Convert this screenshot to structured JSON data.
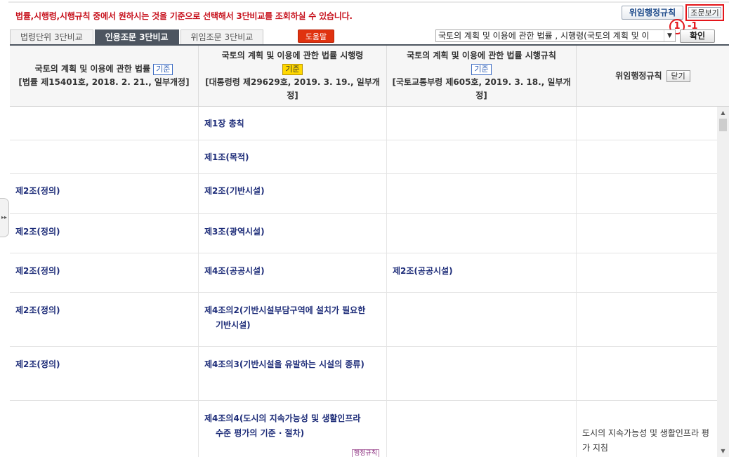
{
  "info_message": "법률,시행령,시행규칙 중에서 원하시는 것을 기준으로 선택해서 3단비교를 조회하실 수 있습니다.",
  "top_buttons": {
    "delegated_rules": "위임행정규칙",
    "article_view": "조문보기"
  },
  "annotation": {
    "number": "1",
    "suffix": "-1"
  },
  "tabs": [
    {
      "label": "법령단위 3단비교",
      "active": false
    },
    {
      "label": "인용조문 3단비교",
      "active": true
    },
    {
      "label": "위임조문 3단비교",
      "active": false
    }
  ],
  "help_label": "도움말",
  "law_select": {
    "value": "국토의 계획 및 이용에 관한 법률 , 시행령(국토의 계획 및 이",
    "arrow": "▼"
  },
  "confirm_label": "확인",
  "columns": [
    {
      "title": "국토의 계획 및 이용에 관한 법률",
      "badge": "기준",
      "sub": "[법률 제15401호, 2018. 2. 21., 일부개정]"
    },
    {
      "title": "국토의 계획 및 이용에 관한 법률 시행령",
      "badge": "기준",
      "sub": "[대통령령 제29629호, 2019. 3. 19., 일부개정]"
    },
    {
      "title": "국토의 계획 및 이용에 관한 법률 시행규칙",
      "badge": "기준",
      "sub": "[국토교통부령 제605호, 2019. 3. 18., 일부개정]"
    },
    {
      "title": "위임행정규칙",
      "close_label": "닫기"
    }
  ],
  "rows": [
    {
      "law": "",
      "decree": "제1장 총칙",
      "rule": "",
      "admin": ""
    },
    {
      "law": "",
      "decree": "제1조(목적)",
      "rule": "",
      "admin": ""
    },
    {
      "law": "제2조(정의)",
      "decree": "제2조(기반시설)",
      "rule": "",
      "admin": ""
    },
    {
      "law": "제2조(정의)",
      "decree": "제3조(광역시설)",
      "rule": "",
      "admin": ""
    },
    {
      "law": "제2조(정의)",
      "decree": "제4조(공공시설)",
      "rule": "제2조(공공시설)",
      "admin": ""
    },
    {
      "law": "제2조(정의)",
      "decree": "제4조의2(기반시설부담구역에 설치가 필요한 기반시설)",
      "rule": "",
      "admin": ""
    },
    {
      "law": "제2조(정의)",
      "decree": "제4조의3(기반시설을 유발하는 시설의 종류)",
      "rule": "",
      "admin": ""
    },
    {
      "law": "",
      "decree": "제4조의4(도시의 지속가능성 및 생활인프라 수준 평가의 기준 · 절차)",
      "rule": "",
      "admin": "도시의 지속가능성 및 생활인프라 평가 지침",
      "tag": "행정규칙"
    }
  ],
  "scroll": {
    "up": "▲",
    "down": "▼"
  },
  "side_toggle_glyph": "▸▸"
}
